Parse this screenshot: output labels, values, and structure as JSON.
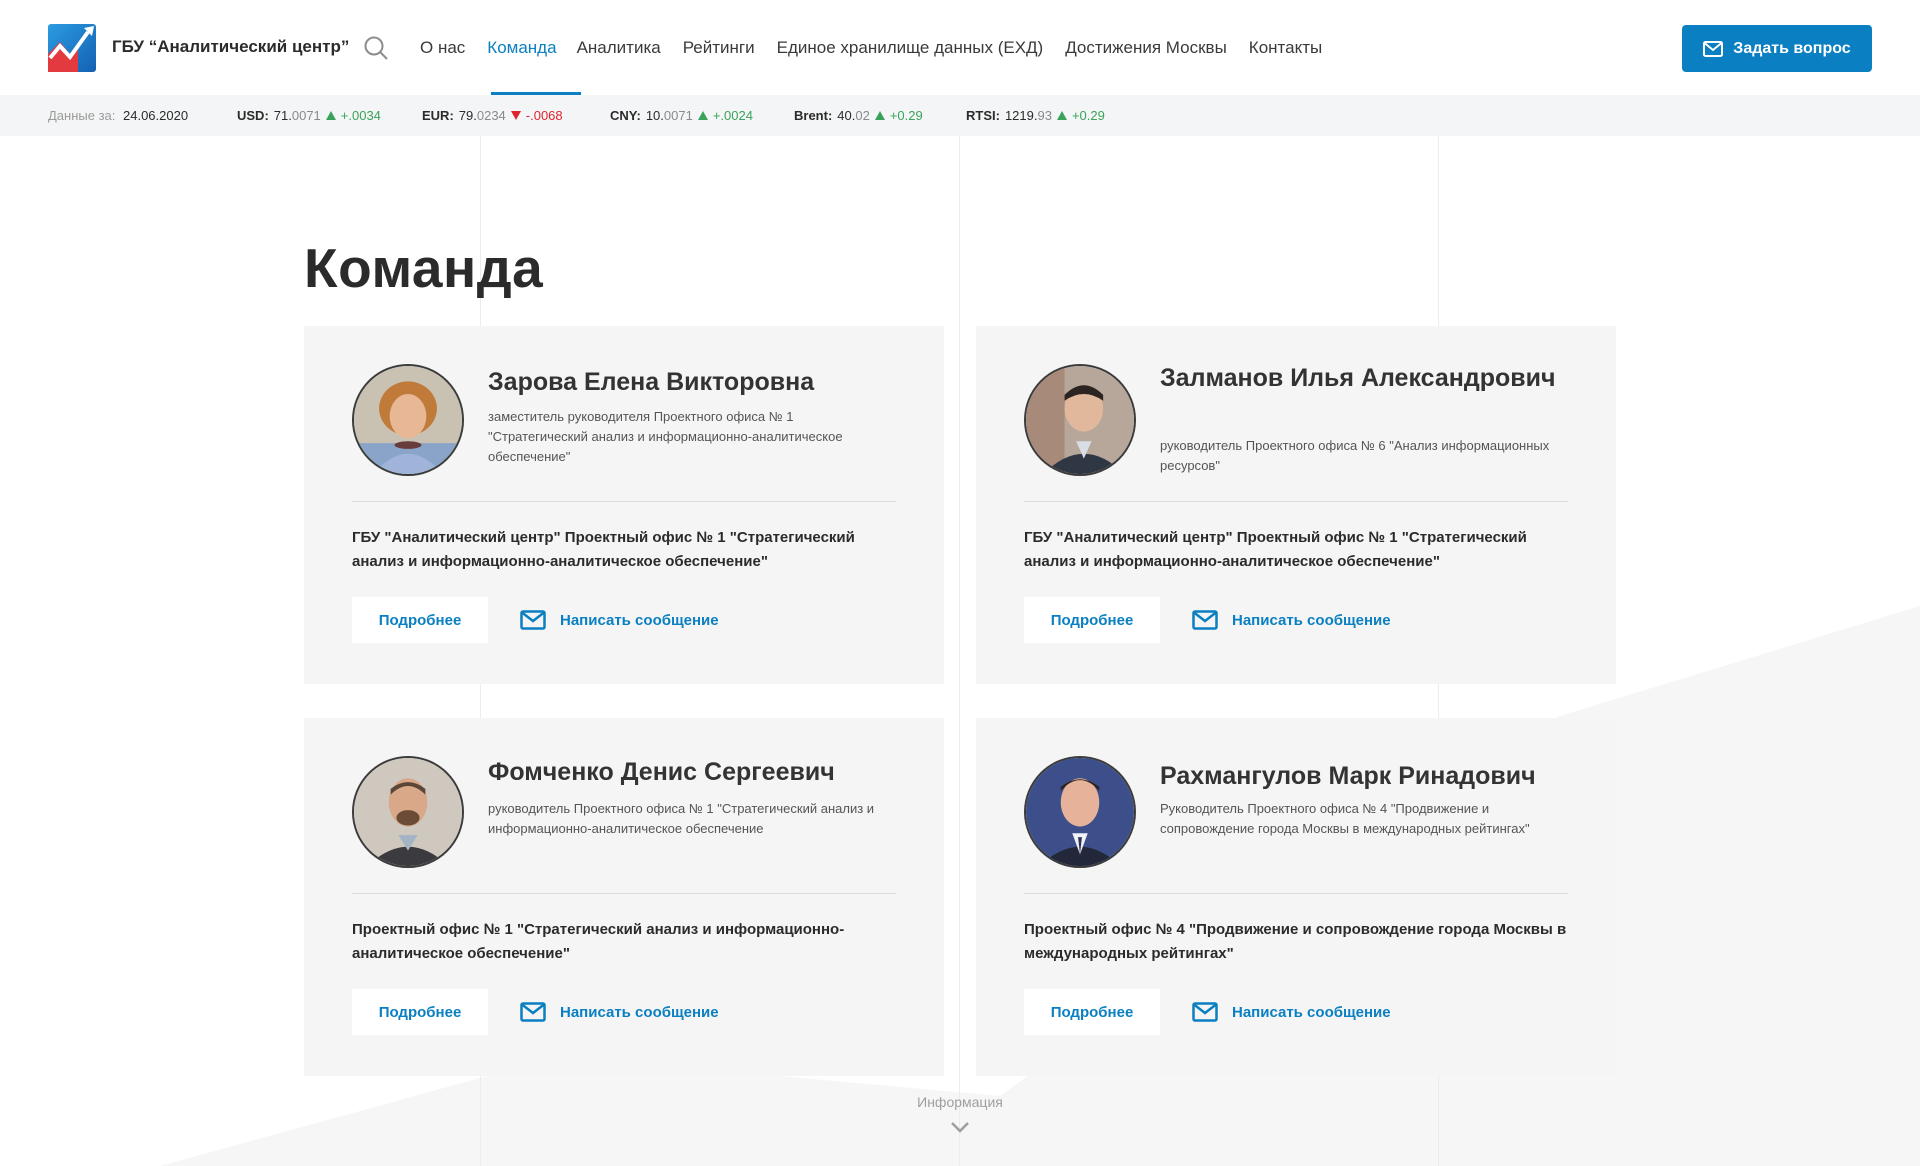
{
  "header": {
    "brand": "ГБУ “Аналитический центр”",
    "nav": [
      {
        "label": "О нас",
        "active": false
      },
      {
        "label": "Команда",
        "active": true
      },
      {
        "label": "Аналитика",
        "active": false
      },
      {
        "label": "Рейтинги",
        "active": false
      },
      {
        "label": "Единое хранилище данных (ЕХД)",
        "active": false
      },
      {
        "label": "Достижения Москвы",
        "active": false
      },
      {
        "label": "Контакты",
        "active": false
      }
    ],
    "cta_label": "Задать вопрос"
  },
  "ticker": {
    "date_label": "Данные за:",
    "date": "24.06.2020",
    "quotes": [
      {
        "name": "USD:",
        "main": "71.",
        "tail": "0071",
        "direction": "up",
        "change": "+.0034"
      },
      {
        "name": "EUR:",
        "main": "79.",
        "tail": "0234",
        "direction": "down",
        "change": "-.0068"
      },
      {
        "name": "CNY:",
        "main": "10.",
        "tail": "0071",
        "direction": "up",
        "change": "+.0024"
      },
      {
        "name": "Brent:",
        "main": "40.",
        "tail": "02",
        "direction": "up",
        "change": "+0.29"
      },
      {
        "name": "RTSI:",
        "main": "1219.",
        "tail": "93",
        "direction": "up",
        "change": "+0.29"
      }
    ]
  },
  "page": {
    "title": "Команда",
    "footer_label": "Информация"
  },
  "cards": [
    {
      "name": "Зарова Елена Викторовна",
      "role": "заместитель руководителя Проектного офиса № 1 \"Стратегический анализ и информационно-аналитическое обеспечение\"",
      "org": "ГБУ \"Аналитический центр\" Проектный офис № 1 \"Стратегический анализ и информационно-аналитическое обеспечение\"",
      "more_label": "Подробнее",
      "message_label": "Написать сообщение"
    },
    {
      "name": "Залманов Илья Александрович",
      "role": "руководитель Проектного офиса № 6 \"Анализ информационных ресурсов\"",
      "org": "ГБУ \"Аналитический центр\" Проектный офис № 1 \"Стратегический анализ и информационно-аналитическое обеспечение\"",
      "more_label": "Подробнее",
      "message_label": "Написать сообщение"
    },
    {
      "name": "Фомченко Денис Сергеевич",
      "role": "руководитель Проектного офиса № 1 \"Стратегический анализ и информационно-аналитическое обеспечение",
      "org": "Проектный офис № 1 \"Стратегический анализ и информационно-аналитическое обеспечение\"",
      "more_label": "Подробнее",
      "message_label": "Написать сообщение"
    },
    {
      "name": "Рахмангулов Марк Ринадович",
      "role": "Руководитель Проектного офиса № 4 \"Продвижение и сопровождение города Москвы в международных рейтингах\"",
      "org": "Проектный офис № 4 \"Продвижение и сопровождение города Москвы в международных рейтингах\"",
      "more_label": "Подробнее",
      "message_label": "Написать сообщение"
    }
  ],
  "colors": {
    "accent": "#0a7fc1",
    "up": "#3aa35a",
    "down": "#e0242f",
    "card_bg": "#f5f5f5"
  }
}
